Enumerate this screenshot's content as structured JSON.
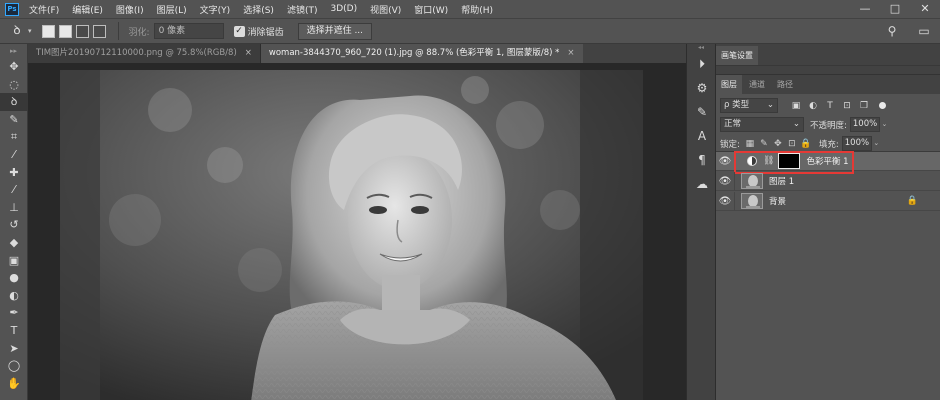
{
  "app": {
    "logo_text": "Ps"
  },
  "menubar": {
    "items": [
      "文件(F)",
      "编辑(E)",
      "图像(I)",
      "图层(L)",
      "文字(Y)",
      "选择(S)",
      "滤镜(T)",
      "3D(D)",
      "视图(V)",
      "窗口(W)",
      "帮助(H)"
    ]
  },
  "window_controls": {
    "minimize": "—",
    "maximize": "□",
    "close": "✕"
  },
  "options_bar": {
    "tool_icon": "lasso-icon",
    "feather_label": "羽化:",
    "feather_value": "0 像素",
    "antialias_label": "消除锯齿",
    "antialias_checked": true,
    "select_mask_label": "选择并遮住 ..."
  },
  "tabs": [
    {
      "label": "TIM图片20190712110000.png @ 75.8%(RGB/8)",
      "close": "×",
      "active": false
    },
    {
      "label": "woman-3844370_960_720 (1).jpg @ 88.7% (色彩平衡 1, 图层蒙版/8) *",
      "close": "×",
      "active": true
    }
  ],
  "toolbar": {
    "grip": "▸▸",
    "tools": [
      {
        "name": "move-tool",
        "icon": "✥",
        "active": false
      },
      {
        "name": "marquee-tool",
        "icon": "◌",
        "active": false
      },
      {
        "name": "lasso-tool",
        "icon": "ꝺ",
        "active": true
      },
      {
        "name": "quick-select-tool",
        "icon": "✎",
        "active": false
      },
      {
        "name": "crop-tool",
        "icon": "⌗",
        "active": false
      },
      {
        "name": "eyedropper-tool",
        "icon": "⁄",
        "active": false
      },
      {
        "name": "healing-tool",
        "icon": "✚",
        "active": false
      },
      {
        "name": "brush-tool",
        "icon": "⁄",
        "active": false
      },
      {
        "name": "stamp-tool",
        "icon": "⊥",
        "active": false
      },
      {
        "name": "history-brush-tool",
        "icon": "↺",
        "active": false
      },
      {
        "name": "eraser-tool",
        "icon": "◆",
        "active": false
      },
      {
        "name": "gradient-tool",
        "icon": "▣",
        "active": false
      },
      {
        "name": "blur-tool",
        "icon": "●",
        "active": false
      },
      {
        "name": "dodge-tool",
        "icon": "◐",
        "active": false
      },
      {
        "name": "pen-tool",
        "icon": "✒",
        "active": false
      },
      {
        "name": "type-tool",
        "icon": "T",
        "active": false
      },
      {
        "name": "path-select-tool",
        "icon": "➤",
        "active": false
      },
      {
        "name": "shape-tool",
        "icon": "◯",
        "active": false
      },
      {
        "name": "hand-tool",
        "icon": "✋",
        "active": false
      }
    ]
  },
  "dock": {
    "icons": [
      {
        "name": "history-icon",
        "glyph": "⏵"
      },
      {
        "name": "adjust-icon",
        "glyph": "⚙"
      },
      {
        "name": "brush-preset-icon",
        "glyph": "✎"
      },
      {
        "name": "character-icon",
        "glyph": "A"
      },
      {
        "name": "paragraph-icon",
        "glyph": "¶"
      },
      {
        "name": "libraries-icon",
        "glyph": "☁"
      }
    ]
  },
  "panels": {
    "brush_tab": "画笔设置",
    "layers_tabs": [
      "图层",
      "通道",
      "路径"
    ],
    "filter_kind": "ρ 类型",
    "filter_icons": [
      {
        "name": "image-filter-icon",
        "glyph": "▣"
      },
      {
        "name": "adjustment-filter-icon",
        "glyph": "◐"
      },
      {
        "name": "type-filter-icon",
        "glyph": "T"
      },
      {
        "name": "shape-filter-icon",
        "glyph": "⊡"
      },
      {
        "name": "smart-object-filter-icon",
        "glyph": "❐"
      }
    ],
    "blend_mode": "正常",
    "opacity_label": "不透明度:",
    "opacity_value": "100%",
    "lock_label": "锁定:",
    "lock_icons": [
      {
        "name": "lock-transparent-icon",
        "glyph": "▦"
      },
      {
        "name": "lock-pixels-icon",
        "glyph": "✎"
      },
      {
        "name": "lock-position-icon",
        "glyph": "✥"
      },
      {
        "name": "lock-artboard-icon",
        "glyph": "⊡"
      },
      {
        "name": "lock-all-icon",
        "glyph": "🔒"
      }
    ],
    "fill_label": "填充:",
    "fill_value": "100%",
    "layers": [
      {
        "name": "色彩平衡 1",
        "kind": "adjustment",
        "selected": true,
        "locked": false
      },
      {
        "name": "图层 1",
        "kind": "pixel",
        "selected": false,
        "locked": false
      },
      {
        "name": "背景",
        "kind": "pixel",
        "selected": false,
        "locked": true
      }
    ]
  },
  "colors": {
    "highlight": "#e53935",
    "accent": "#31a8ff"
  }
}
